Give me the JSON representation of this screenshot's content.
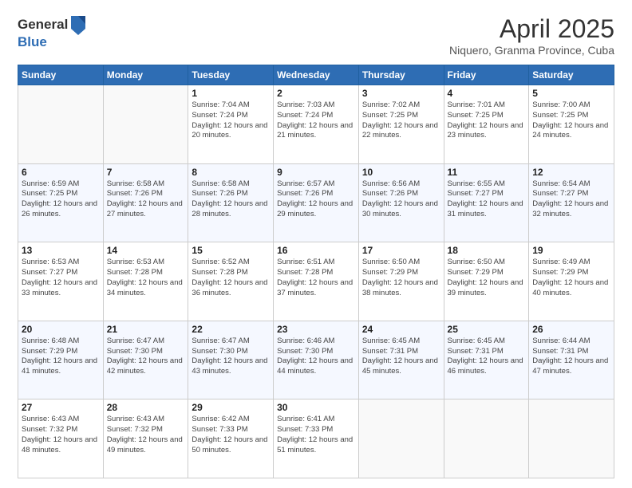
{
  "header": {
    "logo_general": "General",
    "logo_blue": "Blue",
    "month": "April 2025",
    "location": "Niquero, Granma Province, Cuba"
  },
  "days_of_week": [
    "Sunday",
    "Monday",
    "Tuesday",
    "Wednesday",
    "Thursday",
    "Friday",
    "Saturday"
  ],
  "weeks": [
    [
      {
        "day": "",
        "info": ""
      },
      {
        "day": "",
        "info": ""
      },
      {
        "day": "1",
        "info": "Sunrise: 7:04 AM\nSunset: 7:24 PM\nDaylight: 12 hours and 20 minutes."
      },
      {
        "day": "2",
        "info": "Sunrise: 7:03 AM\nSunset: 7:24 PM\nDaylight: 12 hours and 21 minutes."
      },
      {
        "day": "3",
        "info": "Sunrise: 7:02 AM\nSunset: 7:25 PM\nDaylight: 12 hours and 22 minutes."
      },
      {
        "day": "4",
        "info": "Sunrise: 7:01 AM\nSunset: 7:25 PM\nDaylight: 12 hours and 23 minutes."
      },
      {
        "day": "5",
        "info": "Sunrise: 7:00 AM\nSunset: 7:25 PM\nDaylight: 12 hours and 24 minutes."
      }
    ],
    [
      {
        "day": "6",
        "info": "Sunrise: 6:59 AM\nSunset: 7:25 PM\nDaylight: 12 hours and 26 minutes."
      },
      {
        "day": "7",
        "info": "Sunrise: 6:58 AM\nSunset: 7:26 PM\nDaylight: 12 hours and 27 minutes."
      },
      {
        "day": "8",
        "info": "Sunrise: 6:58 AM\nSunset: 7:26 PM\nDaylight: 12 hours and 28 minutes."
      },
      {
        "day": "9",
        "info": "Sunrise: 6:57 AM\nSunset: 7:26 PM\nDaylight: 12 hours and 29 minutes."
      },
      {
        "day": "10",
        "info": "Sunrise: 6:56 AM\nSunset: 7:26 PM\nDaylight: 12 hours and 30 minutes."
      },
      {
        "day": "11",
        "info": "Sunrise: 6:55 AM\nSunset: 7:27 PM\nDaylight: 12 hours and 31 minutes."
      },
      {
        "day": "12",
        "info": "Sunrise: 6:54 AM\nSunset: 7:27 PM\nDaylight: 12 hours and 32 minutes."
      }
    ],
    [
      {
        "day": "13",
        "info": "Sunrise: 6:53 AM\nSunset: 7:27 PM\nDaylight: 12 hours and 33 minutes."
      },
      {
        "day": "14",
        "info": "Sunrise: 6:53 AM\nSunset: 7:28 PM\nDaylight: 12 hours and 34 minutes."
      },
      {
        "day": "15",
        "info": "Sunrise: 6:52 AM\nSunset: 7:28 PM\nDaylight: 12 hours and 36 minutes."
      },
      {
        "day": "16",
        "info": "Sunrise: 6:51 AM\nSunset: 7:28 PM\nDaylight: 12 hours and 37 minutes."
      },
      {
        "day": "17",
        "info": "Sunrise: 6:50 AM\nSunset: 7:29 PM\nDaylight: 12 hours and 38 minutes."
      },
      {
        "day": "18",
        "info": "Sunrise: 6:50 AM\nSunset: 7:29 PM\nDaylight: 12 hours and 39 minutes."
      },
      {
        "day": "19",
        "info": "Sunrise: 6:49 AM\nSunset: 7:29 PM\nDaylight: 12 hours and 40 minutes."
      }
    ],
    [
      {
        "day": "20",
        "info": "Sunrise: 6:48 AM\nSunset: 7:29 PM\nDaylight: 12 hours and 41 minutes."
      },
      {
        "day": "21",
        "info": "Sunrise: 6:47 AM\nSunset: 7:30 PM\nDaylight: 12 hours and 42 minutes."
      },
      {
        "day": "22",
        "info": "Sunrise: 6:47 AM\nSunset: 7:30 PM\nDaylight: 12 hours and 43 minutes."
      },
      {
        "day": "23",
        "info": "Sunrise: 6:46 AM\nSunset: 7:30 PM\nDaylight: 12 hours and 44 minutes."
      },
      {
        "day": "24",
        "info": "Sunrise: 6:45 AM\nSunset: 7:31 PM\nDaylight: 12 hours and 45 minutes."
      },
      {
        "day": "25",
        "info": "Sunrise: 6:45 AM\nSunset: 7:31 PM\nDaylight: 12 hours and 46 minutes."
      },
      {
        "day": "26",
        "info": "Sunrise: 6:44 AM\nSunset: 7:31 PM\nDaylight: 12 hours and 47 minutes."
      }
    ],
    [
      {
        "day": "27",
        "info": "Sunrise: 6:43 AM\nSunset: 7:32 PM\nDaylight: 12 hours and 48 minutes."
      },
      {
        "day": "28",
        "info": "Sunrise: 6:43 AM\nSunset: 7:32 PM\nDaylight: 12 hours and 49 minutes."
      },
      {
        "day": "29",
        "info": "Sunrise: 6:42 AM\nSunset: 7:33 PM\nDaylight: 12 hours and 50 minutes."
      },
      {
        "day": "30",
        "info": "Sunrise: 6:41 AM\nSunset: 7:33 PM\nDaylight: 12 hours and 51 minutes."
      },
      {
        "day": "",
        "info": ""
      },
      {
        "day": "",
        "info": ""
      },
      {
        "day": "",
        "info": ""
      }
    ]
  ]
}
